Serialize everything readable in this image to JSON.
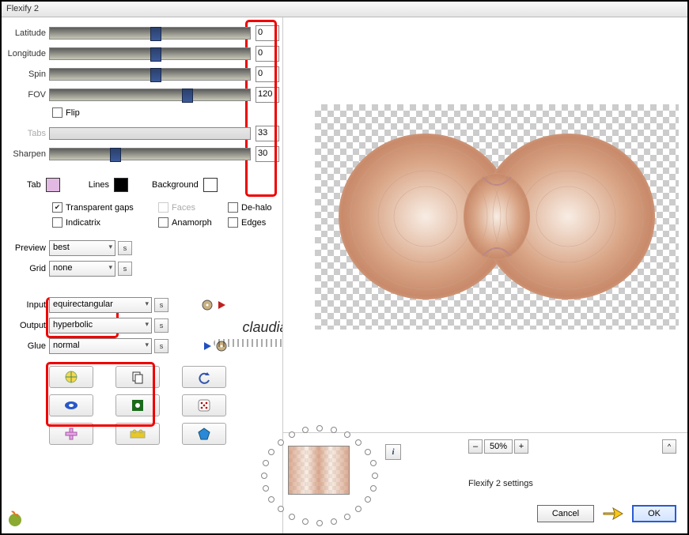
{
  "window": {
    "title": "Flexify 2"
  },
  "sliders": {
    "latitude": {
      "label": "Latitude",
      "value": "0",
      "thumb_pct": 50
    },
    "longitude": {
      "label": "Longitude",
      "value": "0",
      "thumb_pct": 50
    },
    "spin": {
      "label": "Spin",
      "value": "0",
      "thumb_pct": 50
    },
    "fov": {
      "label": "FOV",
      "value": "120",
      "thumb_pct": 66
    },
    "tabs": {
      "label": "Tabs",
      "value": "33",
      "disabled": true
    },
    "sharpen": {
      "label": "Sharpen",
      "value": "30",
      "thumb_pct": 30
    }
  },
  "flip": {
    "label": "Flip",
    "checked": false
  },
  "colors": {
    "tab": {
      "label": "Tab",
      "hex": "#e2b9e2"
    },
    "lines": {
      "label": "Lines",
      "hex": "#000000"
    },
    "background": {
      "label": "Background",
      "hex": "#ffffff"
    }
  },
  "checkboxes": {
    "transparent_gaps": {
      "label": "Transparent gaps",
      "checked": true
    },
    "faces": {
      "label": "Faces",
      "checked": false,
      "disabled": true
    },
    "dehalo": {
      "label": "De-halo",
      "checked": false
    },
    "indicatrix": {
      "label": "Indicatrix",
      "checked": false
    },
    "anamorph": {
      "label": "Anamorph",
      "checked": false
    },
    "edges": {
      "label": "Edges",
      "checked": false
    }
  },
  "selects": {
    "preview": {
      "label": "Preview",
      "value": "best"
    },
    "grid": {
      "label": "Grid",
      "value": "none"
    },
    "input": {
      "label": "Input",
      "value": "equirectangular"
    },
    "output": {
      "label": "Output",
      "value": "hyperbolic"
    },
    "glue": {
      "label": "Glue",
      "value": "normal"
    }
  },
  "settings_btn": "s",
  "zoom": {
    "minus": "–",
    "plus": "+",
    "value": "50%"
  },
  "settings_label": "Flexify 2 settings",
  "buttons": {
    "ok": "OK",
    "cancel": "Cancel"
  },
  "chevron": "^",
  "info": "i",
  "watermark": "claudia"
}
